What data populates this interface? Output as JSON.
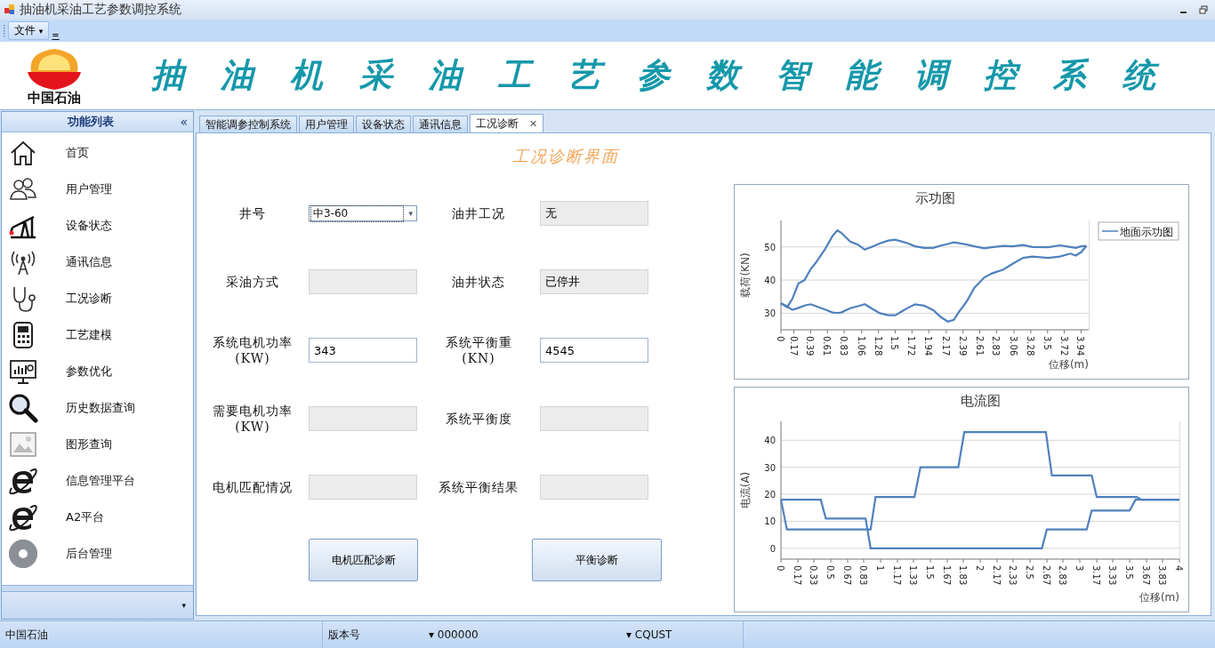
{
  "window": {
    "title": "抽油机采油工艺参数调控系统"
  },
  "menu": {
    "items": [
      {
        "label": "文件",
        "caret": "▾"
      }
    ],
    "overflow": "="
  },
  "banner": {
    "logo_text": "中国石油",
    "title": "抽油机采油工艺参数智能调控系统"
  },
  "sidebar": {
    "title": "功能列表",
    "collapse": "«",
    "items": [
      {
        "label": "首页",
        "kind": "home"
      },
      {
        "label": "用户管理",
        "kind": "users"
      },
      {
        "label": "设备状态",
        "kind": "pumpjack"
      },
      {
        "label": "通讯信息",
        "kind": "antenna"
      },
      {
        "label": "工况诊断",
        "kind": "stethoscope"
      },
      {
        "label": "工艺建模",
        "kind": "device"
      },
      {
        "label": "参数优化",
        "kind": "monitor"
      },
      {
        "label": "历史数据查询",
        "kind": "search"
      },
      {
        "label": "图形查询",
        "kind": "image"
      },
      {
        "label": "信息管理平台",
        "kind": "browser"
      },
      {
        "label": "A2平台",
        "kind": "browser"
      },
      {
        "label": "后台管理",
        "kind": "gear"
      }
    ],
    "footer_caret": "▾"
  },
  "tabs": [
    {
      "label": "智能调参控制系统",
      "selected": false
    },
    {
      "label": "用户管理",
      "selected": false
    },
    {
      "label": "设备状态",
      "selected": false
    },
    {
      "label": "通讯信息",
      "selected": false
    },
    {
      "label": "工况诊断",
      "selected": true,
      "close": "✕"
    }
  ],
  "page": {
    "title": "工况诊断界面",
    "fields": [
      {
        "label": "井号",
        "kind": "combo",
        "value": "中3-60",
        "caret": "▾"
      },
      {
        "label": "油井工况",
        "kind": "text",
        "value": "无",
        "readonly": true
      },
      {
        "label": "采油方式",
        "kind": "text",
        "readonly": true
      },
      {
        "label": "油井状态",
        "kind": "text",
        "value": "已停井",
        "readonly": true
      },
      {
        "label": "系统电机功率",
        "unit": "(KW)",
        "kind": "text",
        "value": "343",
        "readonly": false
      },
      {
        "label": "系统平衡重",
        "unit": "(KN)",
        "kind": "text",
        "value": "4545",
        "readonly": false
      },
      {
        "label": "需要电机功率",
        "unit": "(KW)",
        "kind": "text",
        "readonly": true
      },
      {
        "label": "系统平衡度",
        "kind": "text",
        "readonly": true
      },
      {
        "label": "电机匹配情况",
        "kind": "text",
        "readonly": true
      },
      {
        "label": "系统平衡结果",
        "kind": "text",
        "readonly": true
      }
    ],
    "buttons": [
      "电机匹配诊断",
      "平衡诊断"
    ],
    "charts": [
      {
        "chart_data": {
          "type": "line",
          "title": "示功图",
          "xlabel": "位移(m)",
          "ylabel": "载荷(KN)",
          "xlim": [
            0,
            4.04
          ],
          "ylim": [
            25,
            58
          ],
          "yticks": [
            30,
            40,
            50
          ],
          "grid": true,
          "xticks": [
            0,
            0.17,
            0.39,
            0.61,
            0.83,
            1.06,
            1.28,
            1.5,
            1.72,
            1.94,
            2.17,
            2.39,
            2.61,
            2.83,
            3.06,
            3.28,
            3.5,
            3.72,
            3.94
          ],
          "x": [
            0,
            0.08,
            0.15,
            0.23,
            0.31,
            0.39,
            0.46,
            0.58,
            0.68,
            0.74,
            0.79,
            0.91,
            1.01,
            1.1,
            1.2,
            1.3,
            1.41,
            1.5,
            1.65,
            1.76,
            1.88,
            2.0,
            2.1,
            2.19,
            2.27,
            2.34,
            2.44,
            2.54,
            2.67,
            2.77,
            2.92,
            3.04,
            3.18,
            3.3,
            3.51,
            3.66,
            3.8,
            3.87,
            3.94,
            4.01
          ],
          "series": [
            {
              "name": "地面示功图",
              "color": "#4f81bd",
              "values": [
                33,
                31.8,
                34.3,
                39,
                40,
                43.3,
                45.3,
                49.4,
                53.4,
                55,
                54.3,
                51.6,
                50.7,
                49.2,
                50.1,
                51.1,
                51.9,
                52.2,
                51.2,
                50.2,
                49.7,
                49.7,
                50.4,
                50.9,
                51.4,
                51.1,
                50.7,
                50.2,
                49.6,
                49.9,
                50.3,
                50.2,
                50.6,
                50,
                49.9,
                50.5,
                50,
                49.7,
                50.2,
                50.3
              ]
            },
            {
              "color": "#4f81bd",
              "values": [
                33,
                32.1,
                31,
                31.6,
                32.3,
                32.7,
                32.1,
                31.1,
                30.2,
                30.1,
                30.2,
                31.5,
                32.1,
                32.7,
                31.3,
                30,
                29.4,
                29.4,
                31.4,
                32.7,
                32.3,
                30.9,
                28.8,
                27.5,
                28,
                30.5,
                33.6,
                37.7,
                40.8,
                42,
                43.2,
                44.9,
                46.7,
                47.1,
                46.7,
                47.1,
                48,
                47.4,
                48.4,
                50.3
              ]
            }
          ]
        }
      },
      {
        "chart_data": {
          "type": "line",
          "title": "电流图",
          "xlabel": "位移(m)",
          "ylabel": "电流(A)",
          "xlim": [
            0,
            4
          ],
          "ylim": [
            -4,
            47
          ],
          "yticks": [
            0,
            10,
            20,
            30,
            40
          ],
          "grid": true,
          "xticks": [
            0,
            0.17,
            0.33,
            0.5,
            0.67,
            0.83,
            1,
            1.17,
            1.33,
            1.5,
            1.67,
            1.83,
            2,
            2.17,
            2.33,
            2.5,
            2.67,
            2.83,
            3,
            3.17,
            3.33,
            3.5,
            3.67,
            3.83,
            4
          ],
          "x": [
            0,
            0.06,
            0.4,
            0.45,
            0.85,
            0.9,
            0.95,
            1.34,
            1.4,
            1.78,
            1.84,
            2.62,
            2.66,
            2.67,
            2.72,
            3.07,
            3.12,
            3.17,
            3.5,
            3.56,
            3.57,
            3.62,
            4
          ],
          "series": [
            {
              "color": "#4f81bd",
              "values": [
                18,
                7,
                7,
                7,
                7,
                7,
                19,
                19,
                30,
                30,
                43,
                43,
                43,
                40.3,
                27,
                27,
                27,
                19,
                19,
                19,
                19,
                18,
                18
              ]
            },
            {
              "color": "#4f81bd",
              "values": [
                18,
                18,
                18,
                11,
                11,
                0,
                0,
                0,
                0,
                0,
                0,
                0,
                5.6,
                7,
                7,
                7,
                14,
                14,
                14,
                18,
                18,
                18,
                18
              ]
            }
          ]
        }
      }
    ]
  },
  "status_bar": [
    "中国石油",
    "版本号",
    "000000",
    "CQUST"
  ],
  "status_carets": [
    "▾",
    "▾"
  ]
}
